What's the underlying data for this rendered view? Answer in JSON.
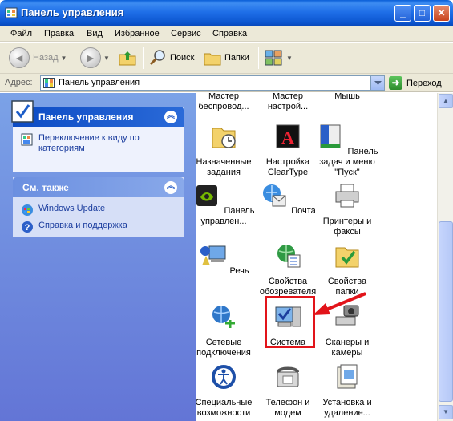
{
  "window": {
    "title": "Панель управления"
  },
  "menu": [
    "Файл",
    "Правка",
    "Вид",
    "Избранное",
    "Сервис",
    "Справка"
  ],
  "toolbar": {
    "back": "Назад",
    "search": "Поиск",
    "folders": "Папки"
  },
  "address": {
    "label": "Адрес:",
    "value": "Панель управления",
    "go": "Переход"
  },
  "tasks_panel": {
    "title": "Панель управления",
    "switch_view": "Переключение к виду по категориям"
  },
  "see_also": {
    "title": "См. также",
    "links": [
      "Windows Update",
      "Справка и поддержка"
    ]
  },
  "items": [
    "Мастер беспровод...",
    "Мастер настрой...",
    "Мышь",
    "Назначенные задания",
    "Настройка ClearType",
    "Панель задач и меню \"Пуск\"",
    "Панель управлен...",
    "Почта",
    "Принтеры и факсы",
    "Речь",
    "Свойства обозревателя",
    "Свойства папки",
    "Сетевые подключения",
    "Система",
    "Сканеры и камеры",
    "Специальные возможности",
    "Телефон и модем",
    "Установка и удаление..."
  ],
  "colors": {
    "title_bar": "#0a5fd8",
    "left_pane": "#7ba2e7",
    "highlight": "#e2141a"
  }
}
